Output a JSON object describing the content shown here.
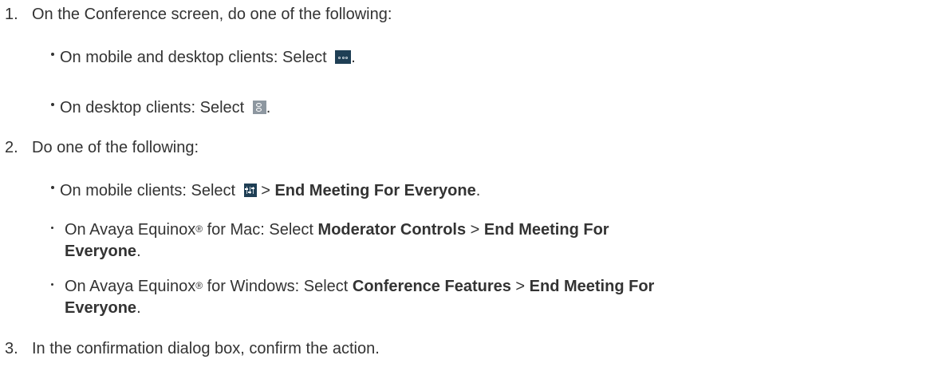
{
  "steps": [
    {
      "number": "1.",
      "text": "On the Conference screen, do one of the following:",
      "items": [
        {
          "prefix": "On mobile and desktop clients: Select ",
          "icon": "more-options-icon",
          "suffix": "."
        },
        {
          "prefix": "On desktop clients: Select ",
          "icon": "participants-icon",
          "suffix": "."
        }
      ]
    },
    {
      "number": "2.",
      "text": "Do one of the following:",
      "items": [
        {
          "prefix": "On mobile clients: Select ",
          "icon": "moderator-controls-icon",
          "sep": " > ",
          "bold": "End Meeting For Everyone",
          "suffix": "."
        },
        {
          "prefix": "On Avaya Equinox",
          "reg": "®",
          "mid": " for Mac: Select ",
          "bold1": "Moderator Controls",
          "sep": " > ",
          "bold2_line1": "End Meeting For",
          "bold2_line2": "Everyone",
          "suffix": "."
        },
        {
          "prefix": "On Avaya Equinox",
          "reg": "®",
          "mid": " for Windows: Select ",
          "bold1": "Conference Features",
          "sep": " > ",
          "bold2_line1": "End Meeting For",
          "bold2_line2": "Everyone",
          "suffix": "."
        }
      ]
    },
    {
      "number": "3.",
      "text": "In the confirmation dialog box, confirm the action."
    }
  ],
  "colors": {
    "text": "#333333",
    "icon_dark": "#1f3f55",
    "icon_gray": "#8d97a0"
  }
}
